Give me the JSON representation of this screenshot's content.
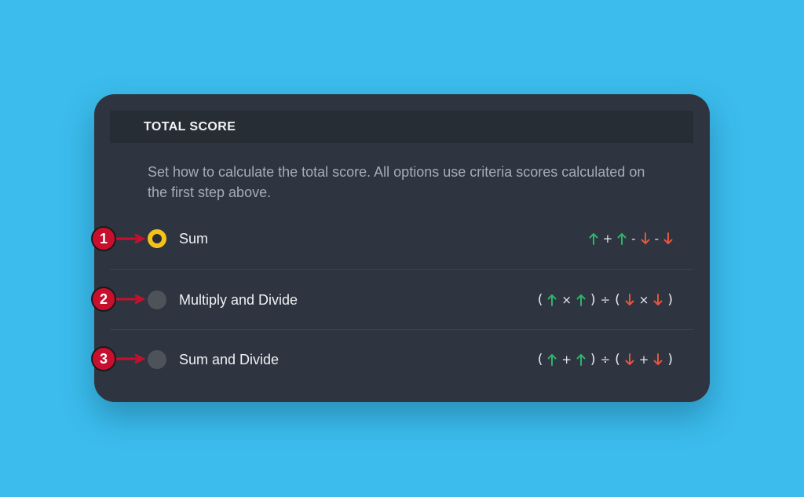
{
  "panel": {
    "title": "TOTAL SCORE",
    "description": "Set how to calculate the total score. All options use criteria scores calculated on the first step above."
  },
  "options": [
    {
      "label": "Sum",
      "selected": true,
      "formula": [
        "up",
        "+",
        "up",
        "-",
        "down",
        "-",
        "down"
      ]
    },
    {
      "label": "Multiply and Divide",
      "selected": false,
      "formula": [
        "(",
        "up",
        "×",
        "up",
        ")",
        "÷",
        "(",
        "down",
        "×",
        "down",
        ")"
      ]
    },
    {
      "label": "Sum and Divide",
      "selected": false,
      "formula": [
        "(",
        "up",
        "+",
        "up",
        ")",
        "÷",
        "(",
        "down",
        "+",
        "down",
        ")"
      ]
    }
  ],
  "callouts": [
    "1",
    "2",
    "3"
  ],
  "colors": {
    "background": "#3bbcec",
    "card": "#2e3540",
    "header": "#272d35",
    "selected_radio": "#f5c21b",
    "unselected_radio": "#4e535a",
    "arrow_up": "#2fb36b",
    "arrow_down": "#e8553e",
    "callout": "#c8102e"
  },
  "icons": {
    "up": "arrow-up-icon",
    "down": "arrow-down-icon"
  }
}
